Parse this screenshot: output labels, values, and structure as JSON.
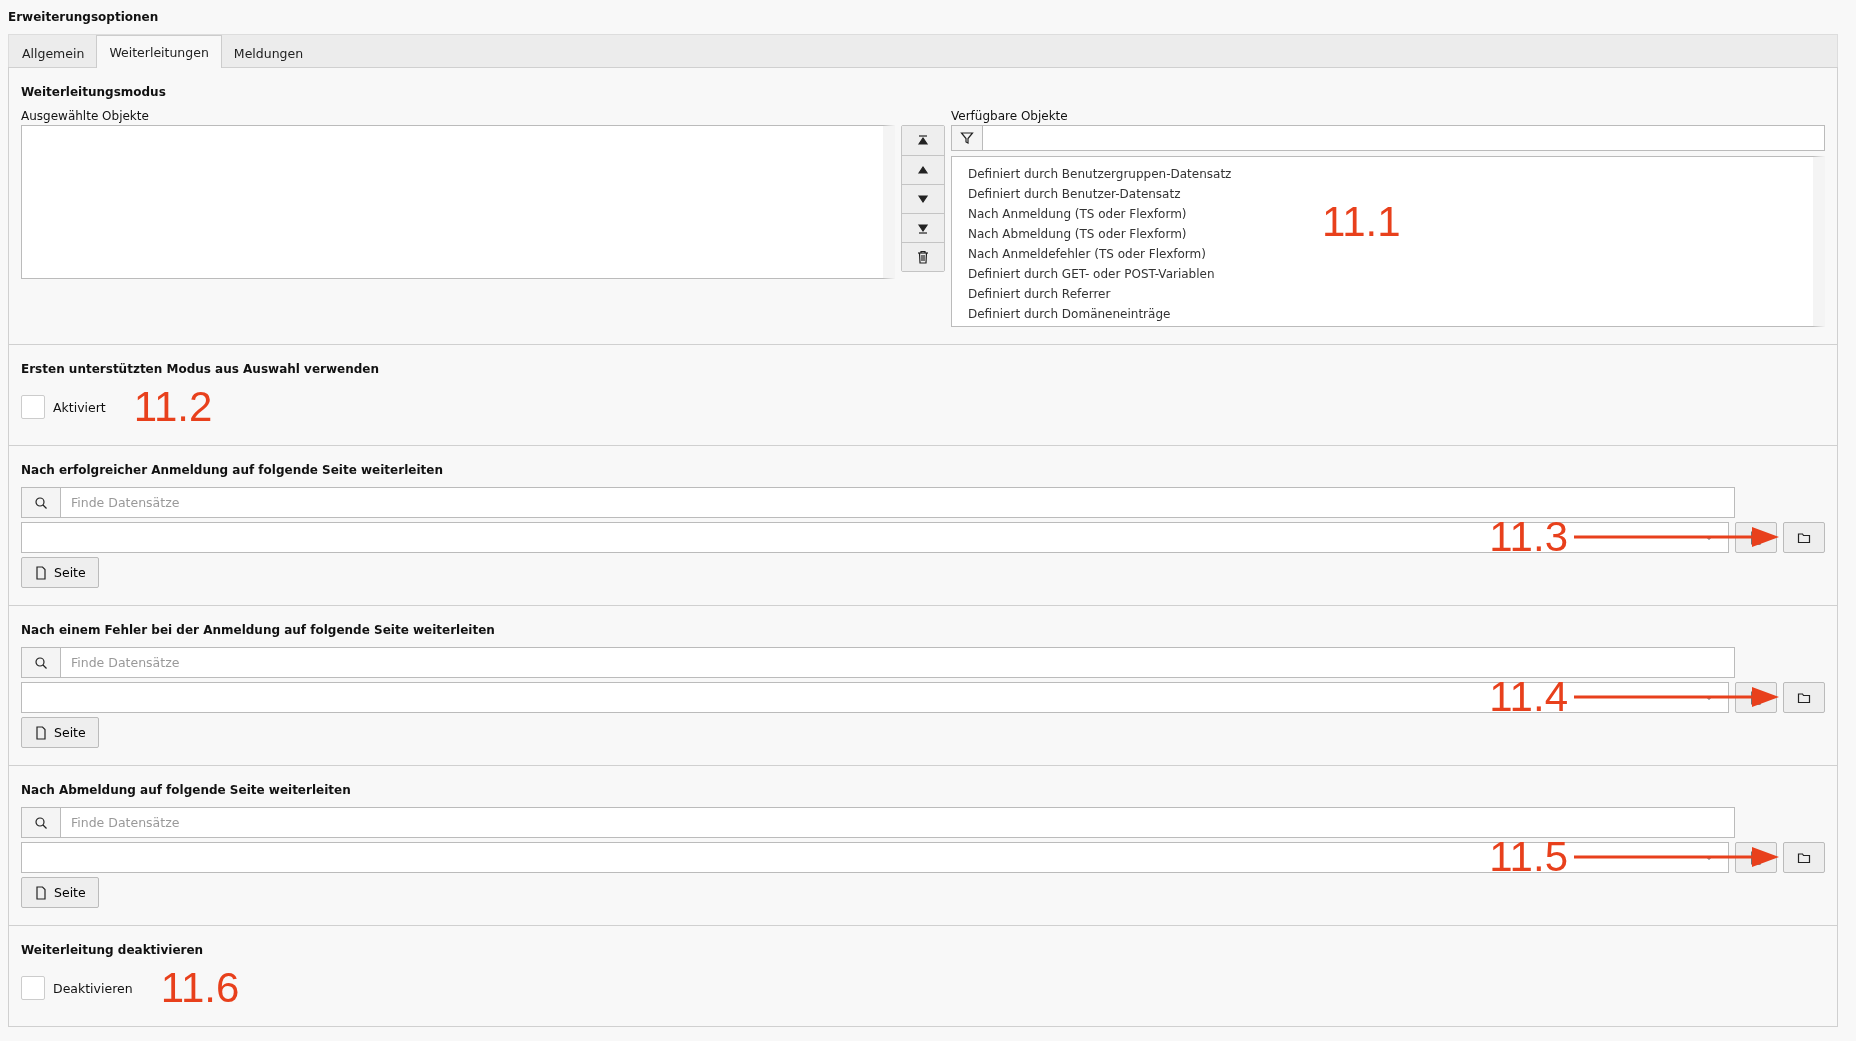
{
  "title": "Erweiterungsoptionen",
  "tabs": [
    {
      "label": "Allgemein",
      "selected": false
    },
    {
      "label": "Weiterleitungen",
      "selected": true
    },
    {
      "label": "Meldungen",
      "selected": false
    }
  ],
  "sections": [
    {
      "kind": "mode",
      "heading": "Weiterleitungsmodus",
      "selected_label": "Ausgewählte Objekte",
      "available_label": "Verfügbare Objekte",
      "available_items": [
        "Definiert durch Benutzergruppen-Datensatz",
        "Definiert durch Benutzer-Datensatz",
        "Nach Anmeldung (TS oder Flexform)",
        "Nach Abmeldung (TS oder Flexform)",
        "Nach Anmeldefehler (TS oder Flexform)",
        "Definiert durch GET- oder POST-Variablen",
        "Definiert durch Referrer",
        "Definiert durch Domäneneinträge"
      ],
      "annotation": "11.1"
    },
    {
      "kind": "checkbox",
      "heading": "Ersten unterstützten Modus aus Auswahl verwenden",
      "label": "Aktiviert",
      "checked": false,
      "annotation": "11.2"
    },
    {
      "kind": "page",
      "heading": "Nach erfolgreicher Anmeldung auf folgende Seite weiterleiten",
      "placeholder": "Finde Datensätze",
      "button": "Seite",
      "annotation": "11.3"
    },
    {
      "kind": "page",
      "heading": "Nach einem Fehler bei der Anmeldung auf folgende Seite weiterleiten",
      "placeholder": "Finde Datensätze",
      "button": "Seite",
      "annotation": "11.4"
    },
    {
      "kind": "page",
      "heading": "Nach Abmeldung auf folgende Seite weiterleiten",
      "placeholder": "Finde Datensätze",
      "button": "Seite",
      "annotation": "11.5"
    },
    {
      "kind": "checkbox",
      "heading": "Weiterleitung deaktivieren",
      "label": "Deaktivieren",
      "checked": false,
      "annotation": "11.6"
    }
  ]
}
